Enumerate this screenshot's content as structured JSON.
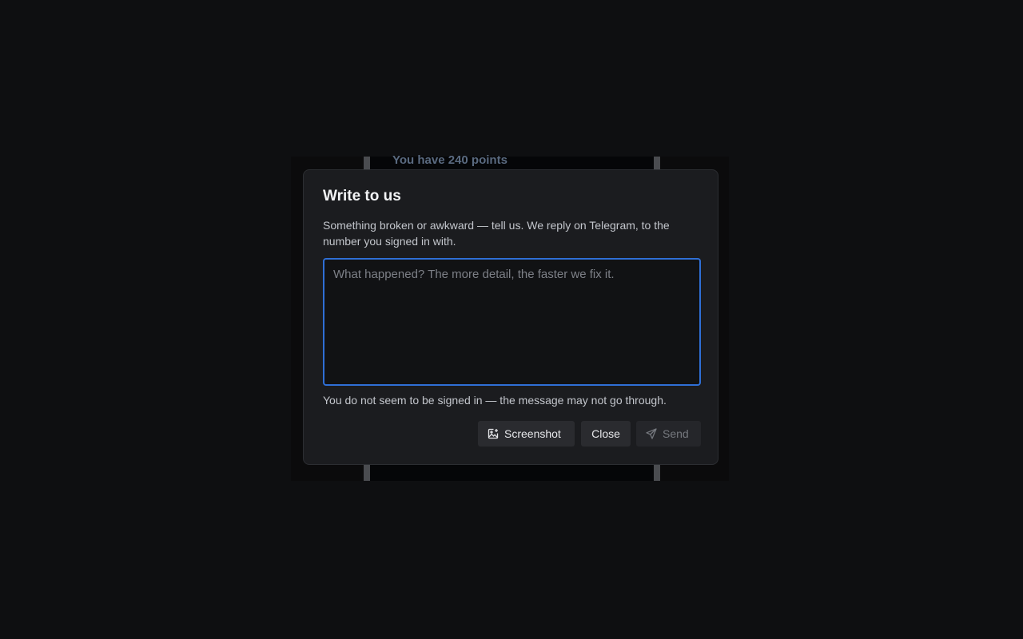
{
  "background": {
    "points_text": "You have 240 points"
  },
  "dialog": {
    "title": "Write to us",
    "description": "Something broken or awkward — tell us. We reply on Telegram, to the number you signed in with.",
    "input": {
      "value": "",
      "placeholder": "What happened? The more detail, the faster we fix it."
    },
    "warning": "You do not seem to be signed in — the message may not go through.",
    "buttons": {
      "screenshot": {
        "label": "Screenshot",
        "icon": "image-plus-icon"
      },
      "close": {
        "label": "Close"
      },
      "send": {
        "label": "Send",
        "icon": "send-icon",
        "disabled": true
      }
    }
  },
  "colors": {
    "focus_border": "#2f6fd6",
    "dialog_bg": "#1b1c1f",
    "page_bg": "#0e0f11"
  }
}
